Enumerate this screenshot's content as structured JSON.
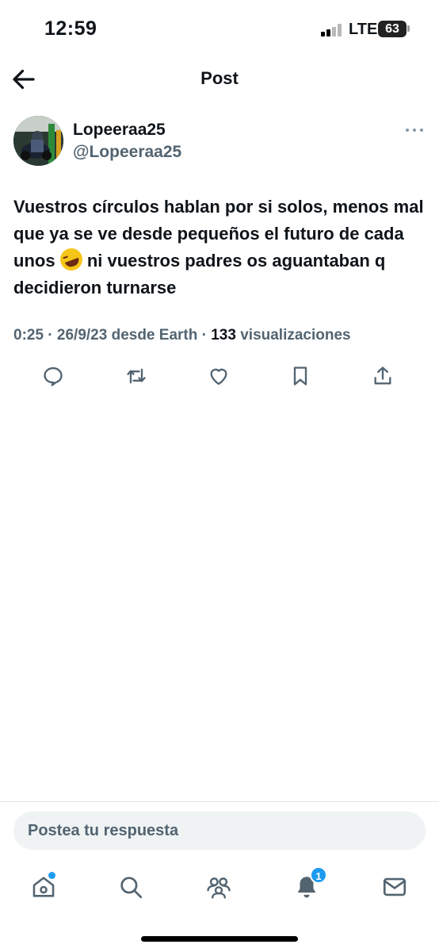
{
  "status_bar": {
    "time": "12:59",
    "network": "LTE",
    "battery": "63"
  },
  "header": {
    "title": "Post",
    "back_icon": "arrow-left-icon"
  },
  "tweet": {
    "display_name": "Lopeeraa25",
    "handle": "@Lopeeraa25",
    "text_part1": "Vuestros círculos hablan por si solos, menos mal que ya se ve desde pequeños el futuro de cada unos",
    "emoji": "rolling-on-floor-laughing-emoji",
    "text_part2": "ni vuestros padres os aguantaban q decidieron turnarse",
    "meta_prefix": "0:25 · 26/9/23 desde Earth · ",
    "view_count": "133",
    "view_label": "visualizaciones"
  },
  "actions": [
    {
      "name": "reply-icon"
    },
    {
      "name": "retweet-icon"
    },
    {
      "name": "like-icon"
    },
    {
      "name": "bookmark-icon"
    },
    {
      "name": "share-icon"
    }
  ],
  "reply": {
    "placeholder": "Postea tu respuesta"
  },
  "tabbar": {
    "notifications_badge": "1",
    "items": [
      "home-icon",
      "search-icon",
      "communities-icon",
      "notifications-icon",
      "messages-icon"
    ]
  },
  "colors": {
    "text": "#0f1419",
    "secondary": "#536471",
    "accent": "#1d9bf0",
    "input_bg": "#eff3f4"
  }
}
